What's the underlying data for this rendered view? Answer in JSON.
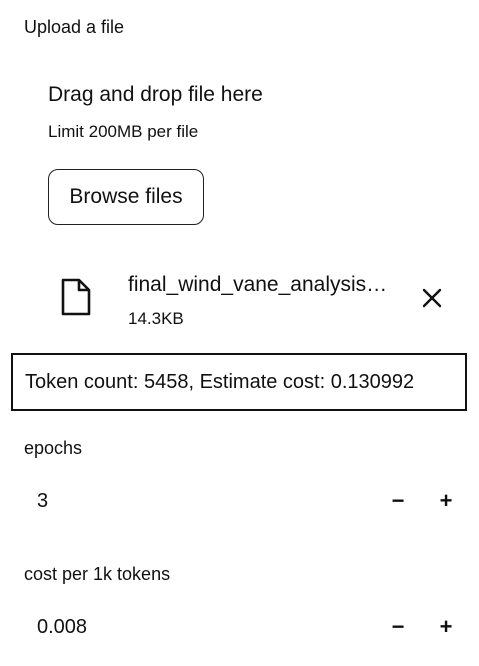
{
  "uploader": {
    "label": "Upload a file",
    "dropzone_title": "Drag and drop file here",
    "dropzone_limit": "Limit 200MB per file",
    "browse_label": "Browse files",
    "file": {
      "name": "final_wind_vane_analysis…",
      "size": "14.3KB",
      "icon": "file-icon",
      "remove_icon": "close-icon"
    }
  },
  "token_info": {
    "text": "Token count: 5458, Estimate cost: 0.130992"
  },
  "epochs": {
    "label": "epochs",
    "value": "3",
    "minus": "−",
    "plus": "+"
  },
  "cost": {
    "label": "cost per 1k tokens",
    "value": "0.008",
    "minus": "−",
    "plus": "+"
  }
}
